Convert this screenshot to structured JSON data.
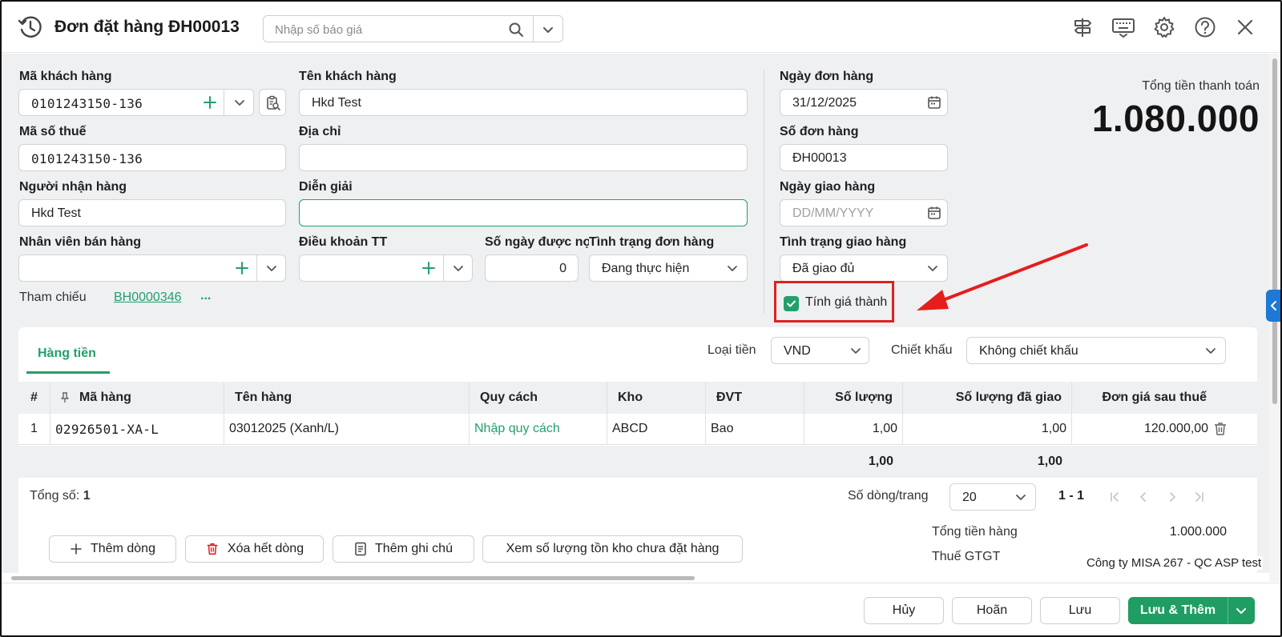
{
  "header": {
    "title": "Đơn đặt hàng ĐH00013",
    "search_placeholder": "Nhập số báo giá"
  },
  "total": {
    "label": "Tổng tiền thanh toán",
    "value": "1.080.000"
  },
  "form": {
    "customer_code_label": "Mã khách hàng",
    "customer_code": "0101243150-136",
    "customer_name_label": "Tên khách hàng",
    "customer_name": "Hkd Test",
    "tax_code_label": "Mã số thuế",
    "tax_code": "0101243150-136",
    "address_label": "Địa chỉ",
    "address": "",
    "receiver_label": "Người nhận hàng",
    "receiver": "Hkd Test",
    "description_label": "Diễn giải",
    "description": "",
    "salesperson_label": "Nhân viên bán hàng",
    "salesperson": "",
    "payment_terms_label": "Điều khoản TT",
    "payment_terms": "",
    "debt_days_label": "Số ngày được nợ",
    "debt_days": "0",
    "order_status_label": "Tình trạng đơn hàng",
    "order_status": "Đang thực hiện",
    "reference_label": "Tham chiếu",
    "reference_link": "BH0000346",
    "reference_more": "...",
    "order_date_label": "Ngày đơn hàng",
    "order_date": "31/12/2025",
    "order_no_label": "Số đơn hàng",
    "order_no": "ĐH00013",
    "delivery_date_label": "Ngày giao hàng",
    "delivery_date_placeholder": "DD/MM/YYYY",
    "delivery_status_label": "Tình trạng giao hàng",
    "delivery_status": "Đã giao đủ",
    "cost_calc_label": "Tính giá thành",
    "cost_calc_checked": true
  },
  "grid": {
    "tab_label": "Hàng tiền",
    "currency_label": "Loại tiền",
    "currency": "VND",
    "discount_label": "Chiết khấu",
    "discount": "Không chiết khấu",
    "columns": [
      "#",
      "Mã hàng",
      "Tên hàng",
      "Quy cách",
      "Kho",
      "ĐVT",
      "Số lượng",
      "Số lượng đã giao",
      "Đơn giá sau thuế"
    ],
    "rows": [
      {
        "no": "1",
        "code": "02926501-XA-L",
        "name": "03012025 (Xanh/L)",
        "spec": "Nhập quy cách",
        "warehouse": "ABCD",
        "unit": "Bao",
        "qty": "1,00",
        "delivered": "1,00",
        "price": "120.000,00"
      }
    ],
    "totals": {
      "qty": "1,00",
      "delivered": "1,00"
    },
    "count_label": "Tổng số:",
    "count": "1",
    "rows_per_page_label": "Số dòng/trang",
    "rows_per_page": "20",
    "page_range": "1 - 1"
  },
  "actions": {
    "add_row": "Thêm dòng",
    "delete_all": "Xóa hết dòng",
    "add_note": "Thêm ghi chú",
    "view_stock": "Xem số lượng tồn kho chưa đặt hàng"
  },
  "summary": {
    "goods_total_label": "Tổng tiền hàng",
    "goods_total": "1.000.000",
    "vat_label": "Thuế GTGT"
  },
  "company": "Công ty MISA 267 - QC ASP test",
  "footer": {
    "cancel": "Hủy",
    "defer": "Hoãn",
    "save": "Lưu",
    "save_add": "Lưu & Thêm"
  },
  "colors": {
    "accent": "#22a06b",
    "primary_button": "#1f9d62",
    "highlight": "#e02020",
    "side_toggle": "#1e78d6"
  }
}
